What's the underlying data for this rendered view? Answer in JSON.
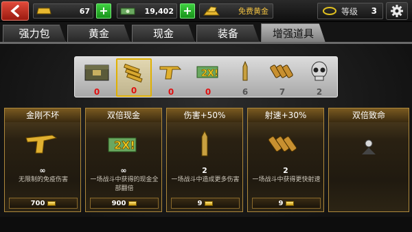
{
  "topbar": {
    "gold_amount": "67",
    "cash_amount": "19,402",
    "free_gold_label": "免费黄金",
    "level_label": "等级",
    "level_value": "3"
  },
  "tabs": [
    {
      "label": "强力包",
      "active": false
    },
    {
      "label": "黄金",
      "active": false
    },
    {
      "label": "现金",
      "active": false
    },
    {
      "label": "装备",
      "active": false
    },
    {
      "label": "增强道具",
      "active": true
    }
  ],
  "strip": [
    {
      "icon": "ammo-crate-icon",
      "count": "0"
    },
    {
      "icon": "gold-ammo-icon",
      "count": "0",
      "selected": true
    },
    {
      "icon": "golden-pistol-icon",
      "count": "0"
    },
    {
      "icon": "double-cash-icon",
      "count": "0"
    },
    {
      "icon": "bullet-icon",
      "count": "6"
    },
    {
      "icon": "bullet-belt-icon",
      "count": "7"
    },
    {
      "icon": "skull-icon",
      "count": "2"
    }
  ],
  "cards": [
    {
      "title": "金刚不坏",
      "qty": "∞",
      "desc": "无限制的免疫伤害",
      "price": "700"
    },
    {
      "title": "双倍现金",
      "qty": "∞",
      "desc": "一场战斗中获得的现金全部翻倍",
      "price": "900"
    },
    {
      "title": "伤害+50%",
      "qty": "2",
      "desc": "一场战斗中造成更多伤害",
      "price": "9"
    },
    {
      "title": "射速+30%",
      "qty": "2",
      "desc": "一场战斗中获得更快射速",
      "price": "9"
    },
    {
      "title": "双倍致命",
      "qty": "",
      "desc": "",
      "price": ""
    }
  ],
  "colors": {
    "accent_gold": "#b08a3c",
    "count_zero": "#e01010",
    "plus_green": "#2ebd30",
    "back_red": "#c8321e"
  }
}
